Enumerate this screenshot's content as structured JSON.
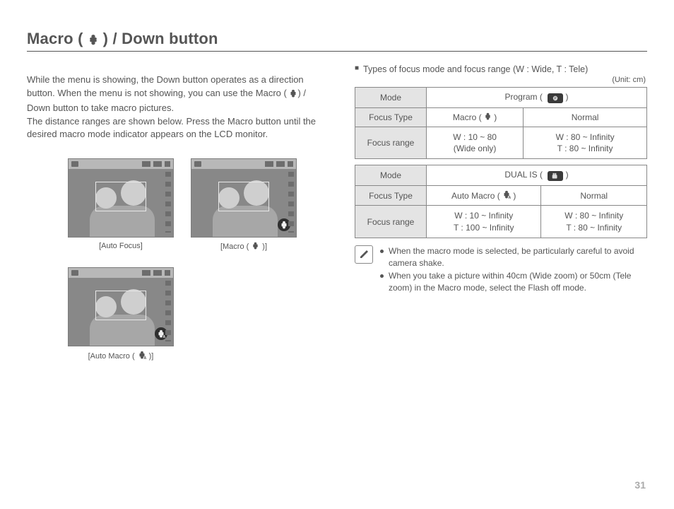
{
  "title_prefix": "Macro (",
  "title_suffix": ") / Down button",
  "intro_line1": "While the menu is showing, the Down button operates as a direction button. When the menu is not showing, you can use the Macro (",
  "intro_line1b": ") / Down button to take macro pictures.",
  "intro_line2": "The distance ranges are shown below. Press the Macro button until the desired macro mode indicator appears on the LCD monitor.",
  "captions": {
    "auto_focus": "[Auto Focus]",
    "macro_pre": "[Macro ( ",
    "macro_post": " )]",
    "auto_macro_pre": "[Auto Macro ( ",
    "auto_macro_post": " )]"
  },
  "types_heading": "Types of focus mode and focus range (W : Wide, T : Tele)",
  "unit_label": "(Unit: cm)",
  "labels": {
    "mode": "Mode",
    "focus_type": "Focus Type",
    "focus_range": "Focus range",
    "normal": "Normal"
  },
  "table1": {
    "mode_name": "Program",
    "col1_type": "Macro",
    "col1_range_a": "W : 10 ~ 80",
    "col1_range_b": "(Wide only)",
    "col2_range_a": "W : 80 ~ Infinity",
    "col2_range_b": "T : 80 ~ Infinity"
  },
  "table2": {
    "mode_name": "DUAL IS",
    "col1_type": "Auto Macro",
    "col1_range_a": "W : 10 ~ Infinity",
    "col1_range_b": "T : 100 ~ Infinity",
    "col2_range_a": "W : 80 ~ Infinity",
    "col2_range_b": "T : 80 ~ Infinity"
  },
  "notes": {
    "n1": "When the macro mode is selected, be particularly careful to avoid camera shake.",
    "n2": "When you take a picture within 40cm (Wide zoom) or 50cm (Tele zoom) in the Macro mode, select the Flash off mode."
  },
  "page_number": "31"
}
